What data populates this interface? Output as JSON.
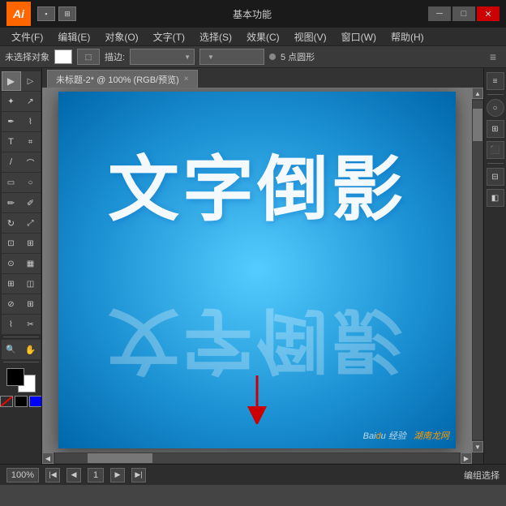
{
  "app": {
    "logo": "Ai",
    "title_center": "基本功能",
    "wm_min": "─",
    "wm_max": "□",
    "wm_close": "✕"
  },
  "menu": {
    "items": [
      "文件(F)",
      "编辑(E)",
      "对象(O)",
      "文字(T)",
      "选择(S)",
      "效果(C)",
      "视图(V)",
      "窗口(W)",
      "帮助(H)"
    ]
  },
  "controlbar": {
    "label": "未选择对象",
    "stroke_label": "描边:",
    "stroke_size": "5 点圆形",
    "settings_icon": "≡"
  },
  "tab": {
    "title": "未标题-2* @ 100% (RGB/预览)",
    "close": "×"
  },
  "artboard": {
    "text_top": "文字倒影",
    "text_bottom": "文字倒影",
    "watermark": "湖南龙网"
  },
  "statusbar": {
    "zoom": "100%",
    "page": "1",
    "status_text": "编组选择"
  },
  "tools": {
    "rows": [
      [
        "▶",
        "▷"
      ],
      [
        "↗",
        "✦"
      ],
      [
        "✏",
        "⊘"
      ],
      [
        "T",
        "⌇"
      ],
      [
        "▭",
        "⬡"
      ],
      [
        "✂",
        "↕"
      ],
      [
        "/",
        "⌇"
      ],
      [
        "⊙",
        "⟳"
      ],
      [
        "🔍",
        "✋"
      ],
      [
        "📐",
        "⬛"
      ]
    ]
  }
}
